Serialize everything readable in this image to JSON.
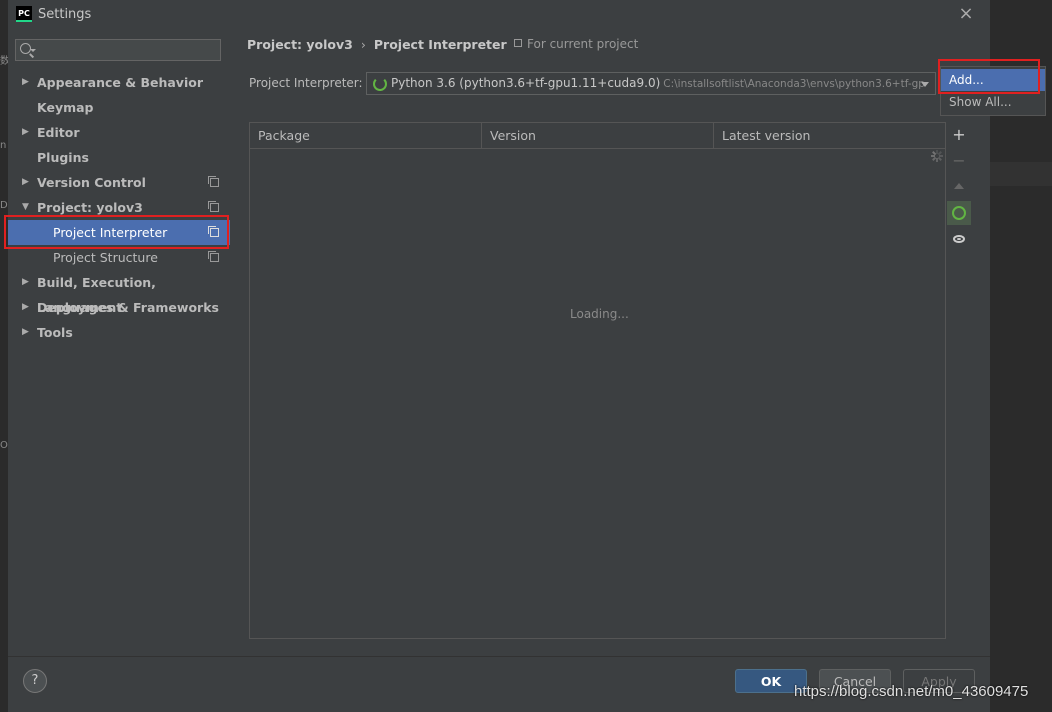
{
  "window": {
    "title": "Settings",
    "icon_text": "PC"
  },
  "sidebar": {
    "search": {
      "placeholder": "",
      "value": ""
    },
    "items": [
      {
        "label": "Appearance & Behavior",
        "arrow": "right",
        "bold": true,
        "copy": false
      },
      {
        "label": "Keymap",
        "arrow": "",
        "bold": true,
        "copy": false
      },
      {
        "label": "Editor",
        "arrow": "right",
        "bold": true,
        "copy": false
      },
      {
        "label": "Plugins",
        "arrow": "",
        "bold": true,
        "copy": false
      },
      {
        "label": "Version Control",
        "arrow": "right",
        "bold": true,
        "copy": true
      },
      {
        "label": "Project: yolov3",
        "arrow": "down",
        "bold": true,
        "copy": true
      },
      {
        "label": "Project Interpreter",
        "arrow": "",
        "bold": false,
        "copy": true,
        "selected": true,
        "sub": true
      },
      {
        "label": "Project Structure",
        "arrow": "",
        "bold": false,
        "copy": true,
        "sub": true
      },
      {
        "label": "Build, Execution, Deployment",
        "arrow": "right",
        "bold": true,
        "copy": false
      },
      {
        "label": "Languages & Frameworks",
        "arrow": "right",
        "bold": true,
        "copy": false
      },
      {
        "label": "Tools",
        "arrow": "right",
        "bold": true,
        "copy": false
      }
    ]
  },
  "breadcrumb": {
    "project": "Project: yolov3",
    "separator": "›",
    "page": "Project Interpreter",
    "scope": "For current project"
  },
  "interpreter": {
    "label": "Project Interpreter:",
    "name": "Python 3.6 (python3.6+tf-gpu1.11+cuda9.0)",
    "path": "C:\\installsoftlist\\Anaconda3\\envs\\python3.6+tf-gp"
  },
  "popup_menu": {
    "items": [
      "Add...",
      "Show All..."
    ]
  },
  "packages_table": {
    "columns": [
      "Package",
      "Version",
      "Latest version"
    ],
    "rows": [],
    "loading_text": "Loading..."
  },
  "side_tools": {
    "add": "+",
    "remove": "−"
  },
  "footer": {
    "help": "?",
    "ok": "OK",
    "cancel": "Cancel",
    "apply": "Apply"
  },
  "watermark": "https://blog.csdn.net/m0_43609475",
  "colors": {
    "selection": "#4b6eaf",
    "highlight_box": "#e02020",
    "ok_button": "#365880",
    "spinner": "#62b543"
  }
}
